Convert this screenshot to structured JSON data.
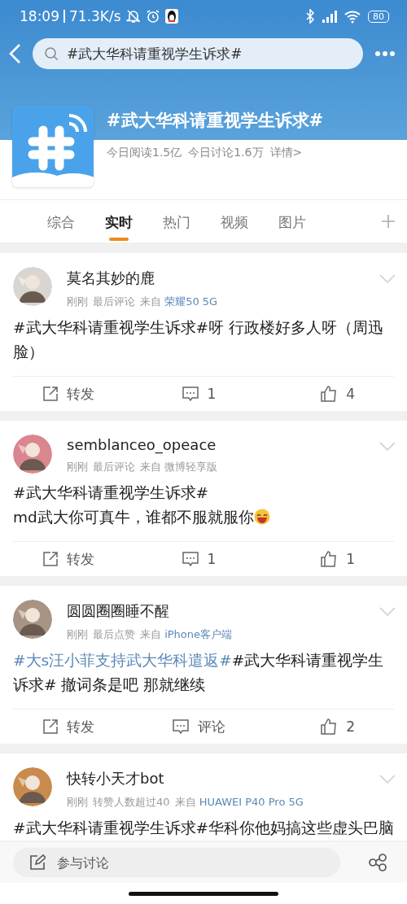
{
  "status_bar": {
    "time": "18:09",
    "speed": "71.3K/s",
    "battery": "80"
  },
  "search": {
    "value": "#武大华科请重视学生诉求#"
  },
  "topic": {
    "title": "#武大华科请重视学生诉求#",
    "stats": [
      "今日阅读1.5亿",
      "今日讨论1.6万"
    ],
    "details": "详情>"
  },
  "tabs": [
    {
      "label": "综合",
      "selected": false
    },
    {
      "label": "实时",
      "selected": true
    },
    {
      "label": "热门",
      "selected": false
    },
    {
      "label": "视频",
      "selected": false
    },
    {
      "label": "图片",
      "selected": false
    }
  ],
  "posts": [
    {
      "name": "莫名其妙的鹿",
      "time": "刚刚",
      "activity": "最后评论",
      "source_label": "来自",
      "device": "荣耀50 5G",
      "device_linked": true,
      "body": [
        {
          "kind": "text",
          "text": "#武大华科请重视学生诉求#呀 行政楼好多人呀（周迅脸）"
        }
      ],
      "repost": "转发",
      "comment": "1",
      "like": "4"
    },
    {
      "name": "semblanceo_opeace",
      "time": "刚刚",
      "activity": "最后评论",
      "source_label": "来自",
      "device": "微博轻享版",
      "device_linked": false,
      "body": [
        {
          "kind": "text",
          "text": "#武大华科请重视学生诉求#"
        },
        {
          "kind": "break"
        },
        {
          "kind": "text",
          "text": "md武大你可真牛，谁都不服就服你"
        },
        {
          "kind": "emoji"
        }
      ],
      "repost": "转发",
      "comment": "1",
      "like": "1"
    },
    {
      "name": "圆圆圈圈睡不醒",
      "time": "刚刚",
      "activity": "最后点赞",
      "source_label": "来自",
      "device": "iPhone客户端",
      "device_linked": true,
      "body": [
        {
          "kind": "topic",
          "text": "#大s汪小菲支持武大华科遣返#"
        },
        {
          "kind": "text",
          "text": "#武大华科请重视学生诉求# 撤词条是吧 那就继续"
        }
      ],
      "repost": "转发",
      "comment": "评论",
      "like": "2"
    },
    {
      "name": "快转小天才bot",
      "time": "刚刚",
      "activity": "转赞人数超过40",
      "source_label": "来自",
      "device": "HUAWEI P40 Pro 5G",
      "device_linked": true,
      "body": [
        {
          "kind": "text",
          "text": "#武大华科请重视学生诉求#华科你他妈搞这些虚头巴脑"
        }
      ]
    }
  ],
  "compose": {
    "placeholder": "参与讨论"
  }
}
